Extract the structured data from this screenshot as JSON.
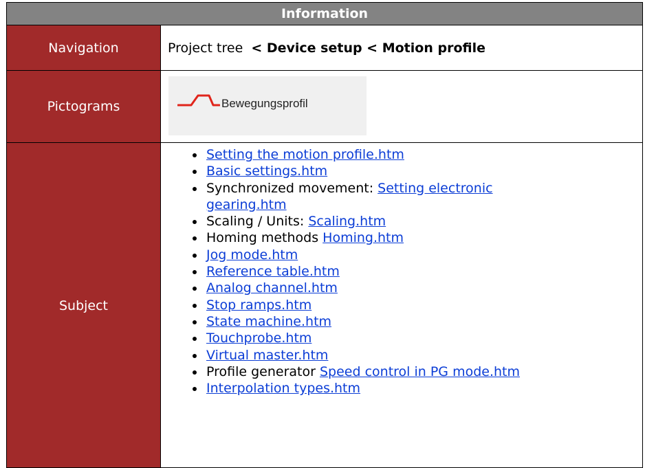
{
  "header": {
    "title": "Information"
  },
  "navigation": {
    "label": "Navigation",
    "prefix": "Project tree ",
    "path": "< Device setup < Motion profile"
  },
  "pictograms": {
    "label": "Pictograms",
    "icon": "motion-profile-trapezoid-icon",
    "icon_text": "Bewegungsprofil",
    "accent_color": "#e0251b"
  },
  "subject": {
    "label": "Subject",
    "items": [
      {
        "prefix": "",
        "link": "Setting the motion profile.htm"
      },
      {
        "prefix": "",
        "link": "Basic settings.htm"
      },
      {
        "prefix": "Synchronized movement: ",
        "link": "Setting electronic",
        "link_cont": "gearing.htm"
      },
      {
        "prefix": "Scaling / Units: ",
        "link": "Scaling.htm"
      },
      {
        "prefix": "Homing methods ",
        "link": "Homing.htm"
      },
      {
        "prefix": "",
        "link": "Jog mode.htm"
      },
      {
        "prefix": "",
        "link": "Reference table.htm"
      },
      {
        "prefix": "",
        "link": "Analog channel.htm"
      },
      {
        "prefix": "",
        "link": "Stop ramps.htm"
      },
      {
        "prefix": "",
        "link": "State machine.htm"
      },
      {
        "prefix": "",
        "link": "Touchprobe.htm"
      },
      {
        "prefix": "",
        "link": "Virtual master.htm"
      },
      {
        "prefix": "Profile generator ",
        "link": "Speed control in PG mode.htm"
      },
      {
        "prefix": "",
        "link": "Interpolation types.htm"
      }
    ]
  }
}
